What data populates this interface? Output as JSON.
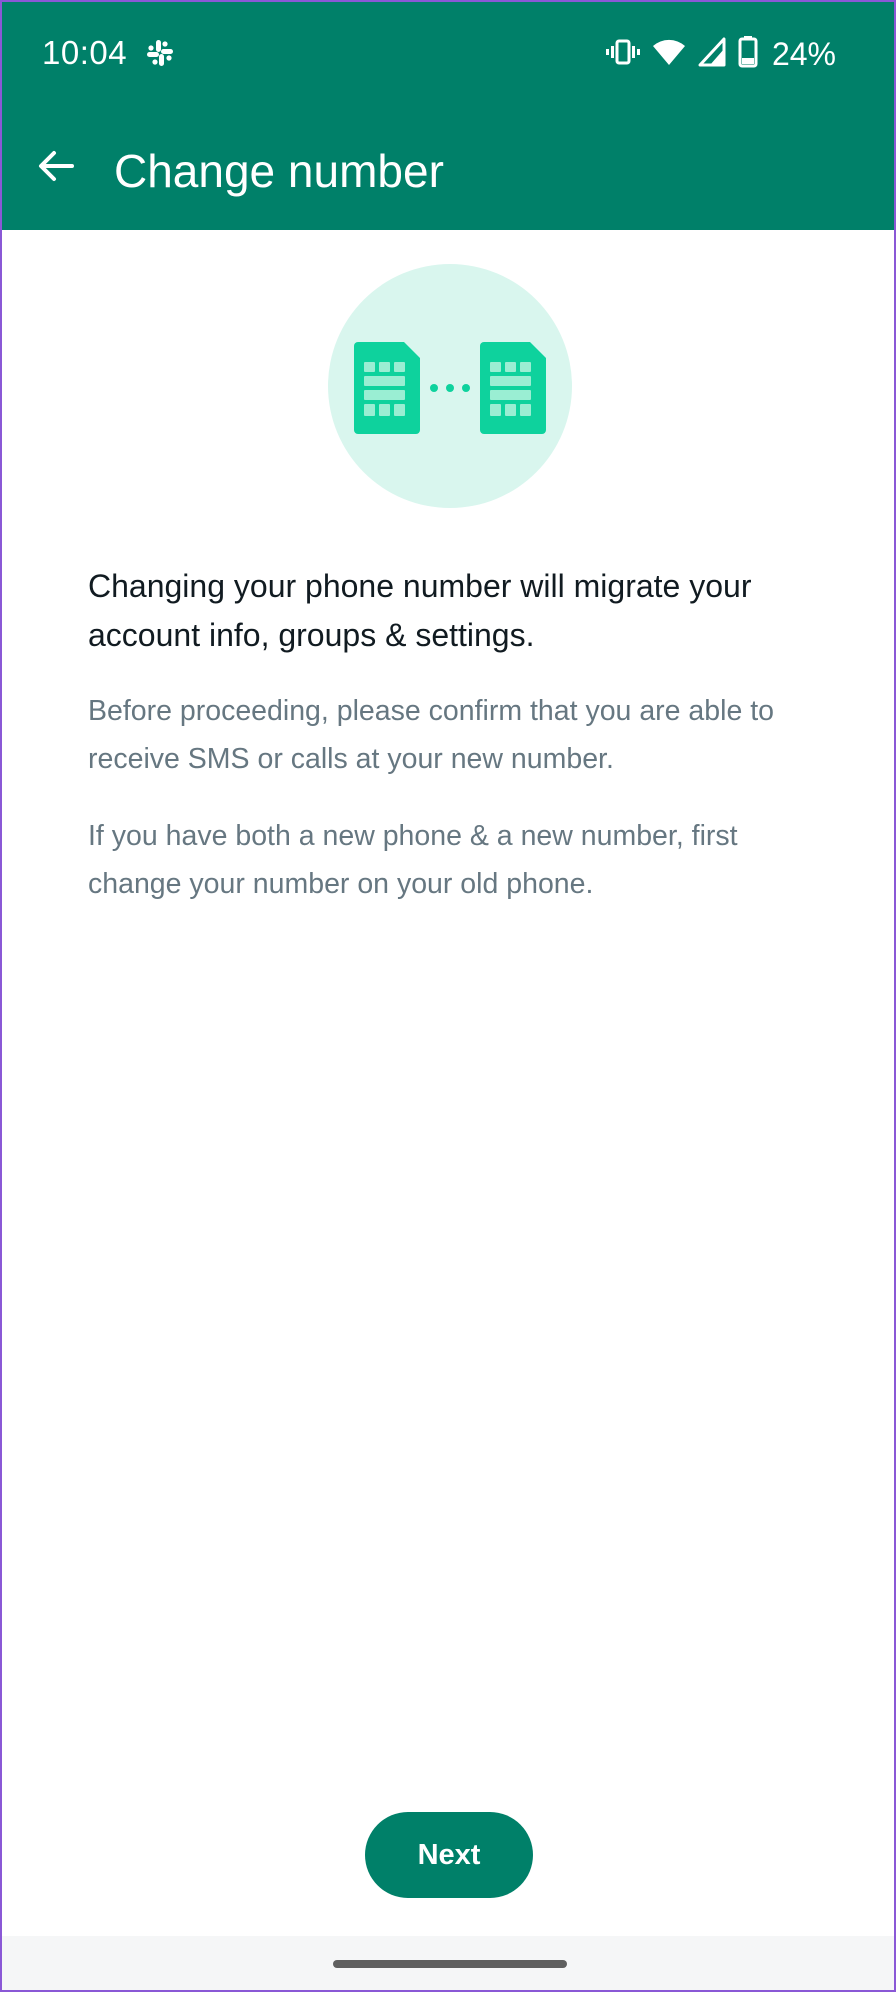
{
  "status_bar": {
    "time": "10:04",
    "battery_percent": "24%",
    "icons": [
      "slack-icon",
      "vibrate-icon",
      "wifi-icon",
      "cell-signal-icon",
      "battery-icon"
    ]
  },
  "app_bar": {
    "title": "Change number",
    "back_icon": "arrow-back-icon",
    "background": "#008069"
  },
  "illustration": {
    "icon": "sim-swap-icon",
    "background": "#d9f6ee",
    "accent": "#0ed29d"
  },
  "content": {
    "headline": "Changing your phone number will migrate your account info, groups & settings.",
    "paragraph_1": "Before proceeding, please confirm that you are able to receive SMS or calls at your new number.",
    "paragraph_2": "If you have both a new phone & a new number, first change your number on your old phone."
  },
  "next_button": {
    "label": "Next",
    "color": "#008069"
  }
}
